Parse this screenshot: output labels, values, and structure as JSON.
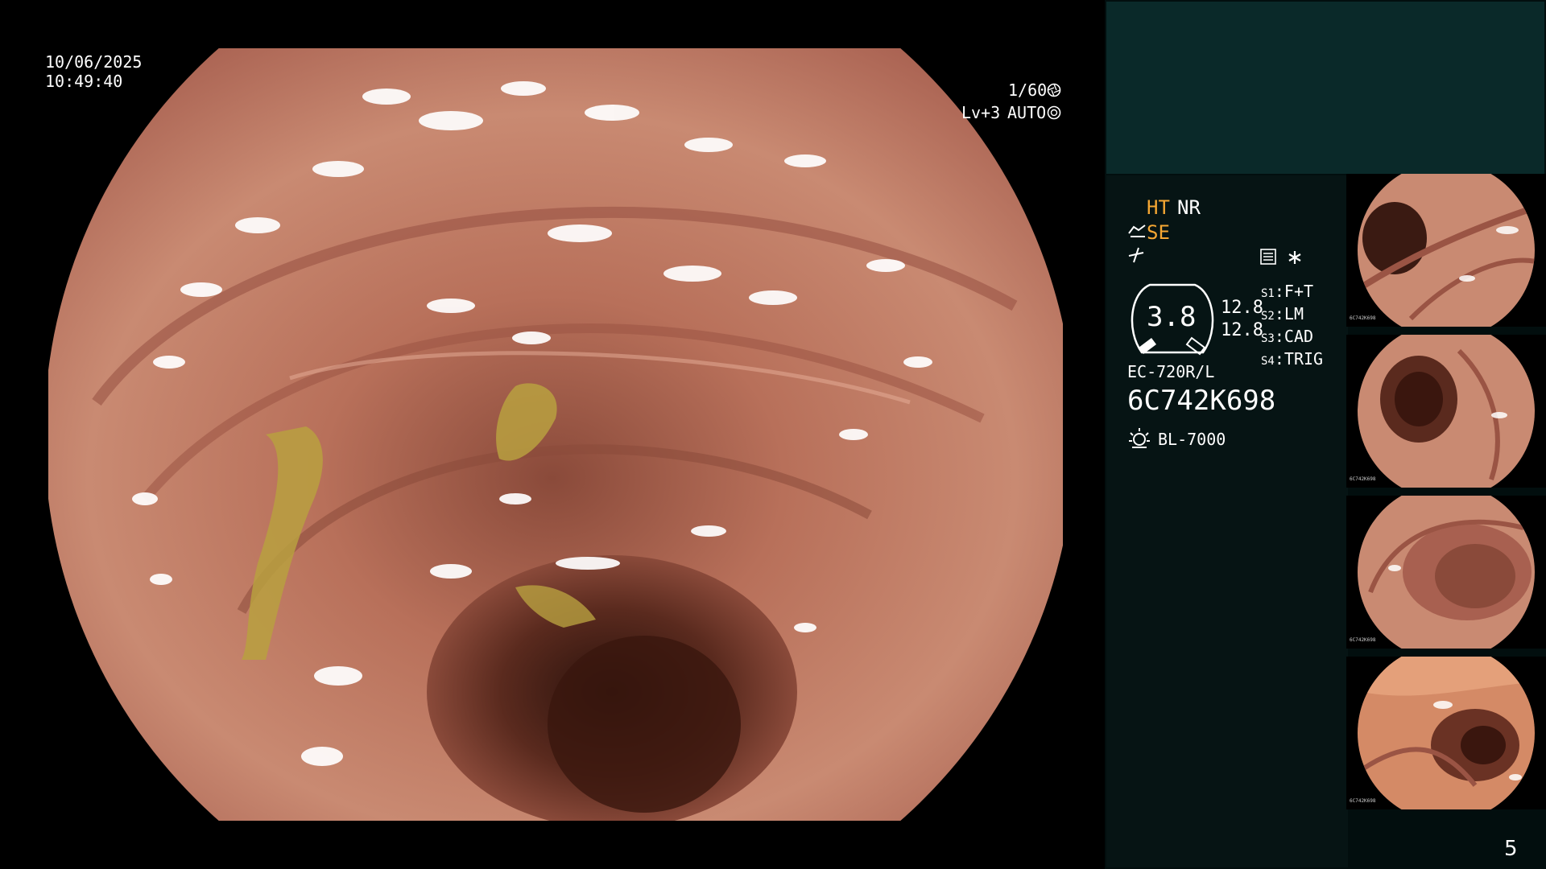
{
  "overlay": {
    "date": "10/06/2025",
    "time": "10:49:40",
    "shutter": "1/60",
    "level": "Lv+3",
    "iris_mode": "AUTO"
  },
  "status": {
    "ht": "HT",
    "nr": "NR",
    "se": "SE"
  },
  "gauge": {
    "value": "3.8",
    "reading_1": "12.8",
    "reading_2": "12.8"
  },
  "switches": [
    {
      "key": "S1",
      "value": "F+T"
    },
    {
      "key": "S2",
      "value": "LM"
    },
    {
      "key": "S3",
      "value": "CAD"
    },
    {
      "key": "S4",
      "value": "TRIG"
    }
  ],
  "scope": {
    "model": "EC-720R/L",
    "serial": "6C742K698",
    "light_source": "BL-7000"
  },
  "thumb_text": {
    "serial": "6C742K698",
    "light": "BL-7000"
  },
  "page_number": "5",
  "colors": {
    "accent": "#f5a733",
    "panel": "#0a2929",
    "mucosa": "#c07a62"
  },
  "icons": [
    "shutter-icon",
    "iris-icon",
    "settings-icon",
    "asterisk-icon",
    "lamp-icon",
    "scope-icon"
  ]
}
